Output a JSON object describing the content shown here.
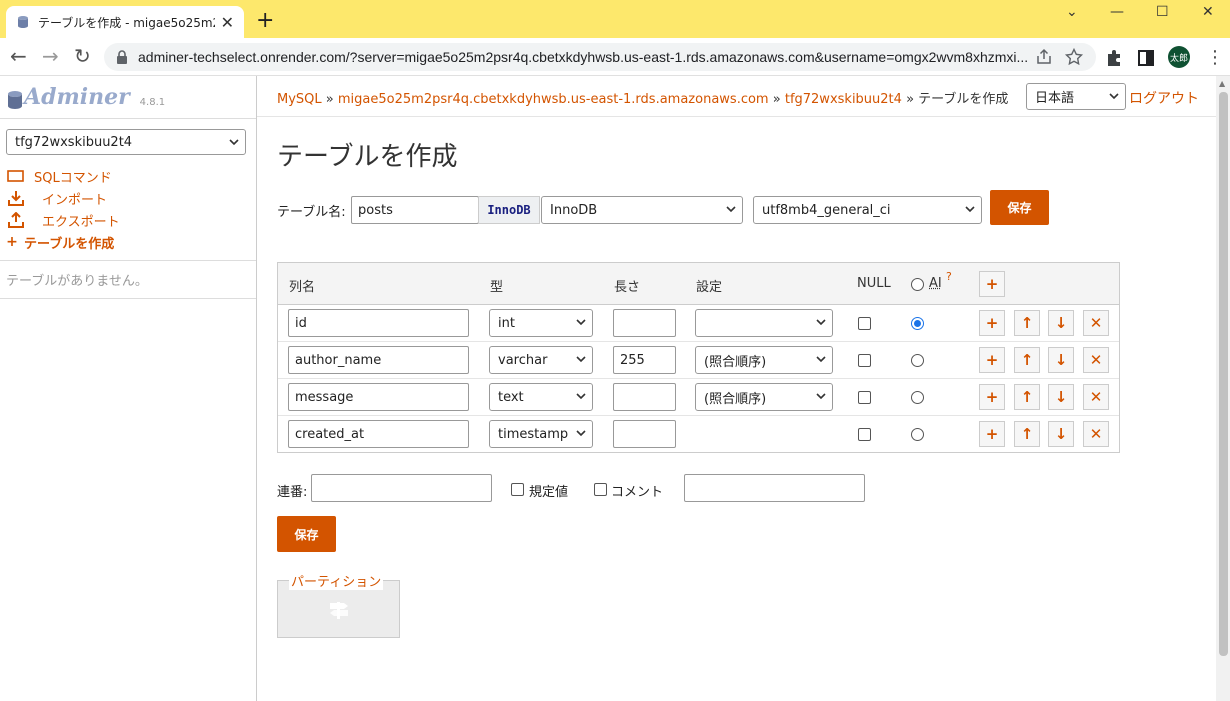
{
  "browser": {
    "tab_title": "テーブルを作成 - migae5o25m2psr4",
    "tab_close": "✕",
    "new_tab": "+",
    "url": "adminer-techselect.onrender.com/?server=migae5o25m2psr4q.cbetxkdyhwsb.us-east-1.rds.amazonaws.com&username=omgx2wvm8xhzmxi...",
    "avatar_text": "太郎",
    "back": "←",
    "forward": "→",
    "reload": "↻",
    "kebab": "⋮",
    "win_minimize": "—",
    "win_maximize": "☐",
    "win_close": "✕",
    "win_collapse": "⌄"
  },
  "sidebar": {
    "logo": "Adminer",
    "version": "4.8.1",
    "db_selected": "tfg72wxskibuu2t4",
    "menu": [
      {
        "label": "SQLコマンド",
        "icon": "sql-command-icon"
      },
      {
        "label": "インポート",
        "icon": "import-icon"
      },
      {
        "label": "エクスポート",
        "icon": "export-icon"
      },
      {
        "label": "テーブルを作成",
        "icon": "plus-icon"
      }
    ],
    "no_tables": "テーブルがありません。"
  },
  "header": {
    "breadcrumb": {
      "driver": "MySQL",
      "sep": "»",
      "server": "migae5o25m2psr4q.cbetxkdyhwsb.us-east-1.rds.amazonaws.com",
      "db": "tfg72wxskibuu2t4",
      "current": "テーブルを作成"
    },
    "language": "日本語",
    "logout": "ログアウト"
  },
  "main": {
    "title": "テーブルを作成",
    "table_name_label": "テーブル名:",
    "table_name_value": "posts",
    "engine_tip": "InnoDB",
    "engine": "InnoDB",
    "collation": "utf8mb4_general_ci",
    "save_label": "保存",
    "columns_header": {
      "name": "列名",
      "type": "型",
      "length": "長さ",
      "options": "設定",
      "null": "NULL",
      "ai": "AI",
      "ai_help": "?"
    },
    "rows": [
      {
        "name": "id",
        "type": "int",
        "length": "",
        "option": "",
        "has_option_select": true,
        "null": false,
        "ai": true
      },
      {
        "name": "author_name",
        "type": "varchar",
        "length": "255",
        "option": "(照合順序)",
        "has_option_select": true,
        "null": false,
        "ai": false
      },
      {
        "name": "message",
        "type": "text",
        "length": "",
        "option": "(照合順序)",
        "has_option_select": true,
        "null": false,
        "ai": false
      },
      {
        "name": "created_at",
        "type": "timestamp",
        "length": "",
        "option": "",
        "has_option_select": false,
        "null": false,
        "ai": false
      }
    ],
    "row_actions": {
      "add": "+",
      "up": "↑",
      "down": "↓",
      "remove": "✕"
    },
    "auto_increment_label": "連番:",
    "auto_increment_value": "",
    "default_label": "規定値",
    "comment_label": "コメント",
    "comment_value": "",
    "partition_label": "パーティション"
  },
  "colors": {
    "accent": "#d35400",
    "tabstrip": "#fde86c",
    "logo": "#99aacc"
  }
}
